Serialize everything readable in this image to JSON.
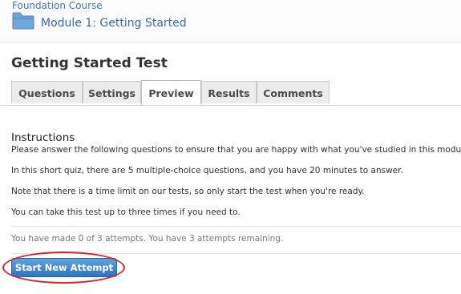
{
  "breadcrumb": {
    "course": "Foundation Course",
    "module": "Module 1: Getting Started"
  },
  "page": {
    "title": "Getting Started Test"
  },
  "tabs": [
    {
      "label": "Questions"
    },
    {
      "label": "Settings"
    },
    {
      "label": "Preview"
    },
    {
      "label": "Results"
    },
    {
      "label": "Comments"
    }
  ],
  "active_tab": "Preview",
  "instructions": {
    "heading": "Instructions",
    "paragraphs": [
      "Please answer the following questions to ensure that you are happy with what you've studied in this module.",
      "In this short quiz, there are 5 multiple-choice questions, and you have 20 minutes to answer.",
      "Note that there is a time limit on our tests, so only start the test when you're ready.",
      "You can take this test up to three times if you need to."
    ]
  },
  "attempts_text": "You have made 0 of 3 attempts. You have 3 attempts remaining.",
  "start_button": {
    "label": "Start New Attempt"
  },
  "icons": {
    "breadcrumb_icon": "folder-icon"
  },
  "colors": {
    "link": "#3a6aa7",
    "button": "#2e74bf",
    "highlight": "#d5222b"
  }
}
